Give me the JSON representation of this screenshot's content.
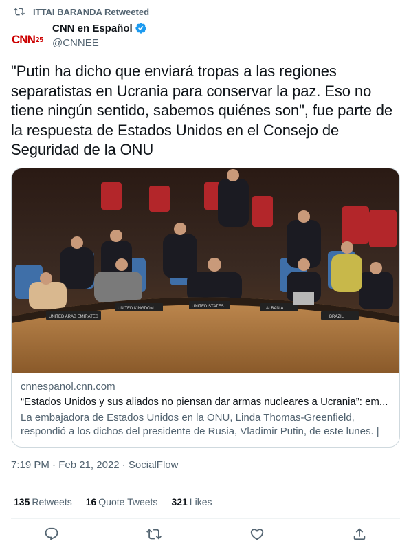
{
  "retweet": {
    "text": "ITTAI BARANDA Retweeted"
  },
  "author": {
    "name": "CNN en Español",
    "handle": "@CNNEE",
    "logo_text": "CNN",
    "logo_badge": "25"
  },
  "tweet": {
    "text": "\"Putin ha dicho que enviará tropas a las regiones separatistas en Ucrania para conservar la paz. Eso no tiene ningún sentido, sabemos quiénes son\", fue parte de la respuesta de Estados Unidos en el Consejo de Seguridad de la ONU"
  },
  "card": {
    "domain": "cnnespanol.cnn.com",
    "title": "“Estados Unidos y sus aliados no piensan dar armas nucleares a Ucrania”: em...",
    "description": "La embajadora de Estados Unidos en la ONU, Linda Thomas-Greenfield, respondió a los dichos del presidente de Rusia, Vladimir Putin, de este lunes. | ...",
    "image_placards": [
      "UNITED STATES",
      "UNITED KINGDOM",
      "UNITED ARAB EMIRATES",
      "ALBANIA",
      "BRAZIL"
    ]
  },
  "meta": {
    "timestamp": "7:19 PM · Feb 21, 2022 · SocialFlow"
  },
  "stats": {
    "retweets_count": "135",
    "retweets_label": "Retweets",
    "quotes_count": "16",
    "quotes_label": "Quote Tweets",
    "likes_count": "321",
    "likes_label": "Likes"
  },
  "colors": {
    "text": "#0f1419",
    "secondary": "#536471",
    "border": "#cfd9de",
    "verified": "#1d9bf0",
    "cnn_red": "#cc0000"
  },
  "icons": [
    "retweet-icon",
    "verified-icon",
    "reply-icon",
    "like-icon",
    "share-icon"
  ]
}
